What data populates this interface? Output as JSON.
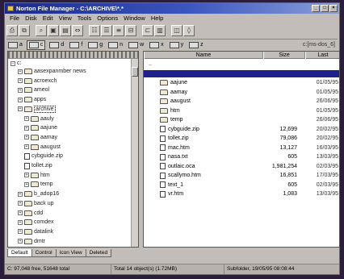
{
  "window": {
    "title": "Norton File Manager - C:\\ARCHIVE\\*.*"
  },
  "menu": [
    "File",
    "Disk",
    "Edit",
    "View",
    "Tools",
    "Options",
    "Window",
    "Help"
  ],
  "toolbar": {
    "icons": [
      "printer-icon",
      "copy-icon",
      "find-icon",
      "view-icon",
      "view2-icon",
      "link-icon",
      "tree-icon",
      "list-icon",
      "details-icon",
      "size-icon",
      "panels-icon",
      "split-icon",
      "left-icon",
      "right-icon"
    ]
  },
  "drives": [
    {
      "label": "a"
    },
    {
      "label": "c",
      "active": true
    },
    {
      "label": "d"
    },
    {
      "label": "f"
    },
    {
      "label": "g"
    },
    {
      "label": "n"
    },
    {
      "label": "w"
    },
    {
      "label": "x"
    },
    {
      "label": "y"
    },
    {
      "label": "z"
    }
  ],
  "drivepath": "c:[ms-dos_6]",
  "tree": {
    "root": "c:",
    "items": [
      {
        "label": "aasexpanmber news",
        "indent": 1
      },
      {
        "label": "acroexch",
        "indent": 1
      },
      {
        "label": "ameol",
        "indent": 1
      },
      {
        "label": "apps",
        "indent": 1
      },
      {
        "label": "archive",
        "indent": 1,
        "selected": true
      },
      {
        "label": "aauly",
        "indent": 2
      },
      {
        "label": "aajune",
        "indent": 2
      },
      {
        "label": "aamay",
        "indent": 2
      },
      {
        "label": "aaugust",
        "indent": 2
      },
      {
        "label": "cybguide.zip",
        "indent": 2,
        "file": true
      },
      {
        "label": "tollet.zip",
        "indent": 2,
        "file": true
      },
      {
        "label": "htm",
        "indent": 2
      },
      {
        "label": "temp",
        "indent": 2
      },
      {
        "label": "b_adop16",
        "indent": 1
      },
      {
        "label": "back up",
        "indent": 1
      },
      {
        "label": "cdd",
        "indent": 1
      },
      {
        "label": "comdex",
        "indent": 1
      },
      {
        "label": "datalink",
        "indent": 1
      },
      {
        "label": "dmtr",
        "indent": 1
      }
    ]
  },
  "list": {
    "columns": [
      "Name",
      "Size",
      "Last"
    ],
    "rows": [
      {
        "name": "..",
        "size": "",
        "date": "",
        "parent": true
      },
      {
        "name": "",
        "size": "",
        "date": "",
        "selected": true
      },
      {
        "name": "aajune",
        "size": "",
        "date": "01/05/95"
      },
      {
        "name": "aamay",
        "size": "",
        "date": "01/05/95"
      },
      {
        "name": "aaugust",
        "size": "",
        "date": "26/06/95"
      },
      {
        "name": "htm",
        "size": "",
        "date": "01/05/95"
      },
      {
        "name": "temp",
        "size": "",
        "date": "26/06/95"
      },
      {
        "name": "cybguide.zip",
        "size": "12,699",
        "date": "20/02/95",
        "file": true
      },
      {
        "name": "tollet.zip",
        "size": "79,086",
        "date": "20/02/95",
        "file": true
      },
      {
        "name": "mac.htm",
        "size": "13,127",
        "date": "16/03/95",
        "file": true
      },
      {
        "name": "nasa.txt",
        "size": "605",
        "date": "13/03/95",
        "file": true
      },
      {
        "name": "outlaic.oca",
        "size": "1,981,254",
        "date": "02/03/95",
        "file": true
      },
      {
        "name": "scallymo.htm",
        "size": "16,851",
        "date": "17/03/95",
        "file": true
      },
      {
        "name": "text_1",
        "size": "605",
        "date": "02/03/95",
        "file": true
      },
      {
        "name": "vr.htm",
        "size": "1,083",
        "date": "13/03/95",
        "file": true
      }
    ]
  },
  "tabs": [
    "Default",
    "Control",
    "Icon View",
    "Deleted"
  ],
  "status": {
    "left": "C: 97,048 free, 51648 total",
    "mid": "Total 14 object(s) (1.72MB)",
    "right": "Subfolder, 19/05/95 08:08:44"
  }
}
